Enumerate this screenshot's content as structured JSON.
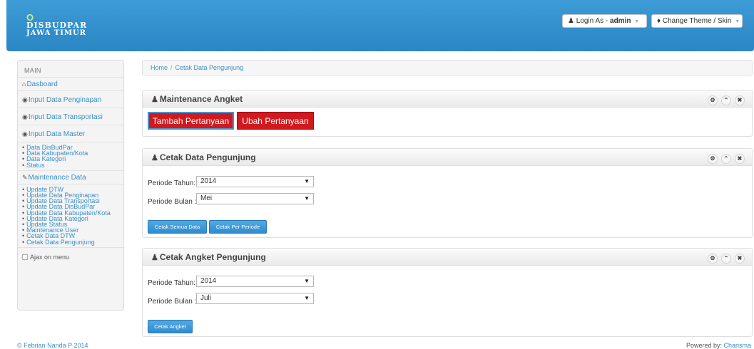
{
  "header": {
    "logo_mark": "O",
    "logo_line1": "DISBUDPAR",
    "logo_line2": "JAWA TIMUR",
    "login_prefix": "Login As - ",
    "login_user": "admin",
    "theme_label": "Change Theme / Skin"
  },
  "sidebar": {
    "heading": "MAIN",
    "dashboard": "Dasboard",
    "input_penginapan": "Input Data Penginapan",
    "input_transportasi": "Input Data Transportasi",
    "input_master": "Input Data Master",
    "master_items": [
      "Data DisBudPar",
      "Data Kabupaten/Kota",
      "Data Kategori",
      "Status"
    ],
    "maintenance_data": "Maintenance Data",
    "maintenance_items": [
      "Update DTW",
      "Update Data Penginapan",
      "Update Data Transportasi",
      "Update Data DisBudPar",
      "Update Data Kabupaten/Kota",
      "Update Data Kategori",
      "Update Status",
      "Maintenance User",
      "Cetak Data DTW",
      "Cetak Data Pengunjung"
    ],
    "ajax_label": "Ajax on menu"
  },
  "breadcrumb": {
    "home": "Home",
    "separator": "/",
    "current": "Cetak Data Pengunjung"
  },
  "box_angket": {
    "title": "Maintenance Angket",
    "btn_tambah": "Tambah Pertanyaan",
    "btn_ubah": "Ubah Pertanyaan"
  },
  "box_pengunjung": {
    "title": "Cetak Data Pengunjung",
    "tahun_label": "Periode Tahun:",
    "tahun_value": "2014",
    "bulan_label": "Periode Bulan :",
    "bulan_value": "Mei",
    "btn_semua": "Cetak Semua Data",
    "btn_periode": "Cetak Per Periode"
  },
  "box_angket_pengunjung": {
    "title": "Cetak Angket Pengunjung",
    "tahun_label": "Periode Tahun:",
    "tahun_value": "2014",
    "bulan_label": "Periode Bulan :",
    "bulan_value": "Juli",
    "btn_cetak": "Cetak Angket"
  },
  "footer": {
    "left": "© Febrian Nanda P 2014",
    "right_prefix": "Powered by: ",
    "right_link": "Charisma"
  },
  "colors": {
    "header": "#2b86c4",
    "red_button": "#cf1a1f",
    "blue_button": "#2e8ccf",
    "link": "#3a8fc9"
  }
}
